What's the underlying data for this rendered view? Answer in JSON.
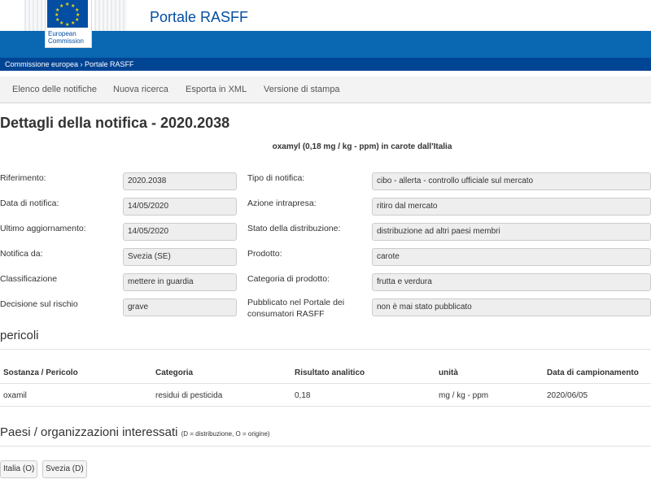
{
  "header": {
    "logo_line1": "European",
    "logo_line2": "Commission",
    "site_title": "Portale RASFF"
  },
  "breadcrumb": "Commissione europea › Portale RASFF",
  "nav": [
    "Elenco delle notifiche",
    "Nuova ricerca",
    "Esporta in XML",
    "Versione di stampa"
  ],
  "page_title": "Dettagli della notifica - 2020.2038",
  "subject": "oxamyl (0,18 mg / kg - ppm) in carote dall'Italia",
  "details_left": [
    {
      "label": "Riferimento:",
      "value": "2020.2038"
    },
    {
      "label": "Data di notifica:",
      "value": "14/05/2020"
    },
    {
      "label": "Ultimo aggiornamento:",
      "value": "14/05/2020"
    },
    {
      "label": "Notifica da:",
      "value": "Svezia (SE)"
    },
    {
      "label": "Classificazione",
      "value": "mettere in guardia"
    },
    {
      "label": "Decisione sul rischio",
      "value": "grave"
    }
  ],
  "details_right": [
    {
      "label": "Tipo di notifica:",
      "value": "cibo - allerta - controllo ufficiale sul mercato"
    },
    {
      "label": "Azione intrapresa:",
      "value": "ritiro dal mercato"
    },
    {
      "label": "Stato della distribuzione:",
      "value": "distribuzione ad altri paesi membri"
    },
    {
      "label": "Prodotto:",
      "value": "carote"
    },
    {
      "label": "Categoria di prodotto:",
      "value": "frutta e verdura"
    },
    {
      "label": "Pubblicato nel Portale dei consumatori RASFF",
      "value": "non è mai stato pubblicato"
    }
  ],
  "hazards": {
    "title": "pericoli",
    "columns": [
      "Sostanza / Pericolo",
      "Categoria",
      "Risultato analitico",
      "unità",
      "Data di campionamento"
    ],
    "rows": [
      [
        "oxamil",
        "residui di pesticida",
        "0,18",
        "mg / kg - ppm",
        "2020/06/05"
      ]
    ]
  },
  "countries": {
    "title": "Paesi / organizzazioni interessati",
    "note": "(D = distribuzione, O = origine)",
    "items": [
      "Italia (O)",
      "Svezia (D)"
    ]
  },
  "colors": {
    "brand_blue": "#034ea2",
    "band_blue": "#0a67b2",
    "breadcrumb_bg": "#004494",
    "eu_star_yellow": "#ffdd00"
  }
}
